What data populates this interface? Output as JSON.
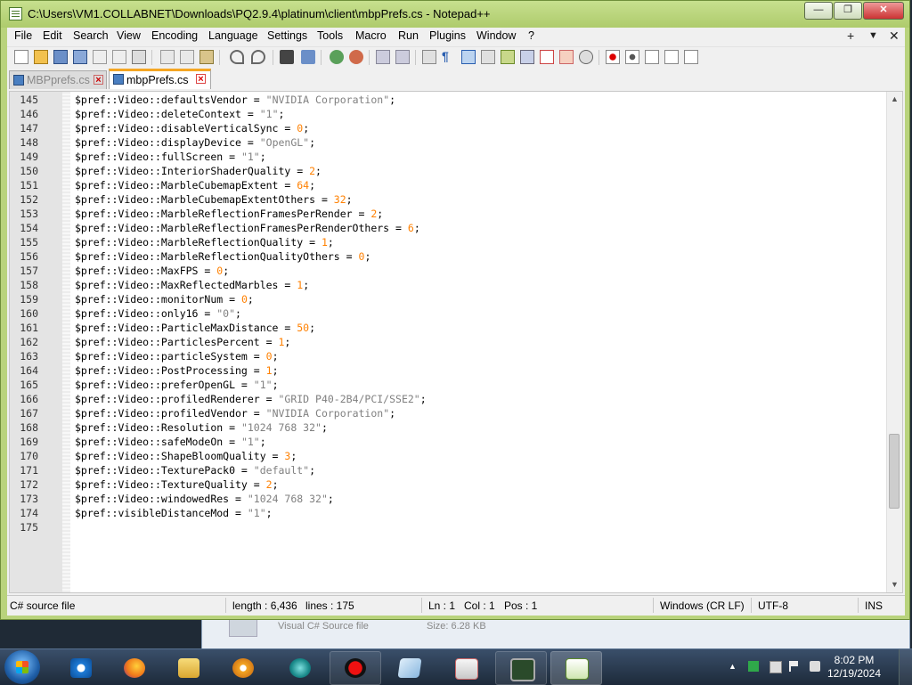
{
  "window": {
    "title": "C:\\Users\\VM1.COLLABNET\\Downloads\\PQ2.9.4\\platinum\\client\\mbpPrefs.cs - Notepad++",
    "minimize": "—",
    "maximize": "❐",
    "close": "✕"
  },
  "menu": {
    "items": [
      "File",
      "Edit",
      "Search",
      "View",
      "Encoding",
      "Language",
      "Settings",
      "Tools",
      "Macro",
      "Run",
      "Plugins",
      "Window",
      "?"
    ],
    "right_plus": "+",
    "right_arrow": "▼",
    "right_close": "✕"
  },
  "tabs": [
    {
      "label": "MBPprefs.cs",
      "active": false
    },
    {
      "label": "mbpPrefs.cs",
      "active": true
    }
  ],
  "editor": {
    "lines": [
      {
        "n": "145",
        "prefix": "$pref::Video::defaultsVendor = ",
        "value": "\"NVIDIA Corporation\"",
        "kind": "str"
      },
      {
        "n": "146",
        "prefix": "$pref::Video::deleteContext = ",
        "value": "\"1\"",
        "kind": "str"
      },
      {
        "n": "147",
        "prefix": "$pref::Video::disableVerticalSync = ",
        "value": "0",
        "kind": "num"
      },
      {
        "n": "148",
        "prefix": "$pref::Video::displayDevice = ",
        "value": "\"OpenGL\"",
        "kind": "str"
      },
      {
        "n": "149",
        "prefix": "$pref::Video::fullScreen = ",
        "value": "\"1\"",
        "kind": "str"
      },
      {
        "n": "150",
        "prefix": "$pref::Video::InteriorShaderQuality = ",
        "value": "2",
        "kind": "num"
      },
      {
        "n": "151",
        "prefix": "$pref::Video::MarbleCubemapExtent = ",
        "value": "64",
        "kind": "num"
      },
      {
        "n": "152",
        "prefix": "$pref::Video::MarbleCubemapExtentOthers = ",
        "value": "32",
        "kind": "num"
      },
      {
        "n": "153",
        "prefix": "$pref::Video::MarbleReflectionFramesPerRender = ",
        "value": "2",
        "kind": "num"
      },
      {
        "n": "154",
        "prefix": "$pref::Video::MarbleReflectionFramesPerRenderOthers = ",
        "value": "6",
        "kind": "num"
      },
      {
        "n": "155",
        "prefix": "$pref::Video::MarbleReflectionQuality = ",
        "value": "1",
        "kind": "num"
      },
      {
        "n": "156",
        "prefix": "$pref::Video::MarbleReflectionQualityOthers = ",
        "value": "0",
        "kind": "num"
      },
      {
        "n": "157",
        "prefix": "$pref::Video::MaxFPS = ",
        "value": "0",
        "kind": "num"
      },
      {
        "n": "158",
        "prefix": "$pref::Video::MaxReflectedMarbles = ",
        "value": "1",
        "kind": "num"
      },
      {
        "n": "159",
        "prefix": "$pref::Video::monitorNum = ",
        "value": "0",
        "kind": "num"
      },
      {
        "n": "160",
        "prefix": "$pref::Video::only16 = ",
        "value": "\"0\"",
        "kind": "str"
      },
      {
        "n": "161",
        "prefix": "$pref::Video::ParticleMaxDistance = ",
        "value": "50",
        "kind": "num"
      },
      {
        "n": "162",
        "prefix": "$pref::Video::ParticlesPercent = ",
        "value": "1",
        "kind": "num"
      },
      {
        "n": "163",
        "prefix": "$pref::Video::particleSystem = ",
        "value": "0",
        "kind": "num"
      },
      {
        "n": "164",
        "prefix": "$pref::Video::PostProcessing = ",
        "value": "1",
        "kind": "num"
      },
      {
        "n": "165",
        "prefix": "$pref::Video::preferOpenGL = ",
        "value": "\"1\"",
        "kind": "str"
      },
      {
        "n": "166",
        "prefix": "$pref::Video::profiledRenderer = ",
        "value": "\"GRID P40-2B4/PCI/SSE2\"",
        "kind": "str"
      },
      {
        "n": "167",
        "prefix": "$pref::Video::profiledVendor = ",
        "value": "\"NVIDIA Corporation\"",
        "kind": "str"
      },
      {
        "n": "168",
        "prefix": "$pref::Video::Resolution = ",
        "value": "\"1024 768 32\"",
        "kind": "str"
      },
      {
        "n": "169",
        "prefix": "$pref::Video::safeModeOn = ",
        "value": "\"1\"",
        "kind": "str"
      },
      {
        "n": "170",
        "prefix": "$pref::Video::ShapeBloomQuality = ",
        "value": "3",
        "kind": "num"
      },
      {
        "n": "171",
        "prefix": "$pref::Video::TexturePack0 = ",
        "value": "\"default\"",
        "kind": "str"
      },
      {
        "n": "172",
        "prefix": "$pref::Video::TextureQuality = ",
        "value": "2",
        "kind": "num"
      },
      {
        "n": "173",
        "prefix": "$pref::Video::windowedRes = ",
        "value": "\"1024 768 32\"",
        "kind": "str"
      },
      {
        "n": "174",
        "prefix": "$pref::visibleDistanceMod = ",
        "value": "\"1\"",
        "kind": "str"
      },
      {
        "n": "175",
        "prefix": "",
        "value": "",
        "kind": "none"
      }
    ]
  },
  "status": {
    "filetype": "C# source file",
    "length": "length : 6,436",
    "lines": "lines : 175",
    "ln": "Ln : 1",
    "col": "Col : 1",
    "pos": "Pos : 1",
    "eol": "Windows (CR LF)",
    "encoding": "UTF-8",
    "mode": "INS"
  },
  "background_window": {
    "type_text": "Visual C# Source file",
    "size_text": "Size: 6.28 KB"
  },
  "taskbar": {
    "time": "8:02 PM",
    "date": "12/19/2024"
  }
}
